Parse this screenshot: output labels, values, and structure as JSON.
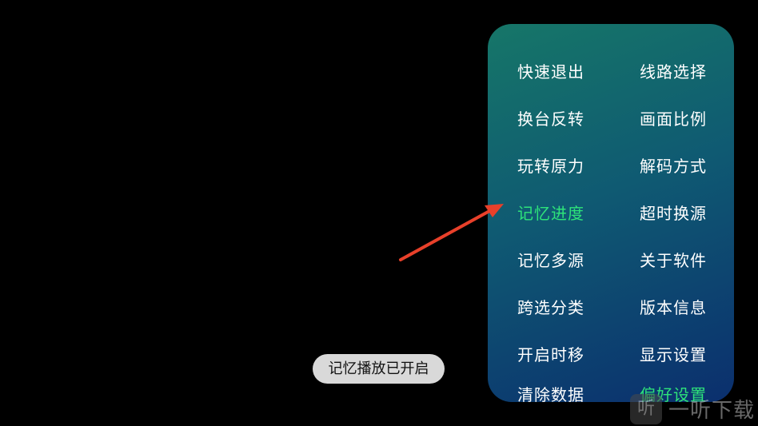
{
  "menu": {
    "left_column": [
      {
        "label": "快速退出",
        "active": false
      },
      {
        "label": "换台反转",
        "active": false
      },
      {
        "label": "玩转原力",
        "active": false
      },
      {
        "label": "记忆进度",
        "active": true
      },
      {
        "label": "记忆多源",
        "active": false
      },
      {
        "label": "跨选分类",
        "active": false
      },
      {
        "label": "开启时移",
        "active": false
      },
      {
        "label": "清除数据",
        "active": false
      }
    ],
    "right_column": [
      {
        "label": "线路选择",
        "active": false
      },
      {
        "label": "画面比例",
        "active": false
      },
      {
        "label": "解码方式",
        "active": false
      },
      {
        "label": "超时换源",
        "active": false
      },
      {
        "label": "关于软件",
        "active": false
      },
      {
        "label": "版本信息",
        "active": false
      },
      {
        "label": "显示设置",
        "active": false
      },
      {
        "label": "偏好设置",
        "active": true
      }
    ]
  },
  "toast": {
    "message": "记忆播放已开启"
  },
  "watermark": {
    "logo_glyph": "听",
    "text": "一听下载"
  },
  "colors": {
    "active_text": "#2ee37a",
    "arrow": "#e8402a",
    "panel_top": "#167668",
    "panel_bottom": "#0b2f6e"
  }
}
